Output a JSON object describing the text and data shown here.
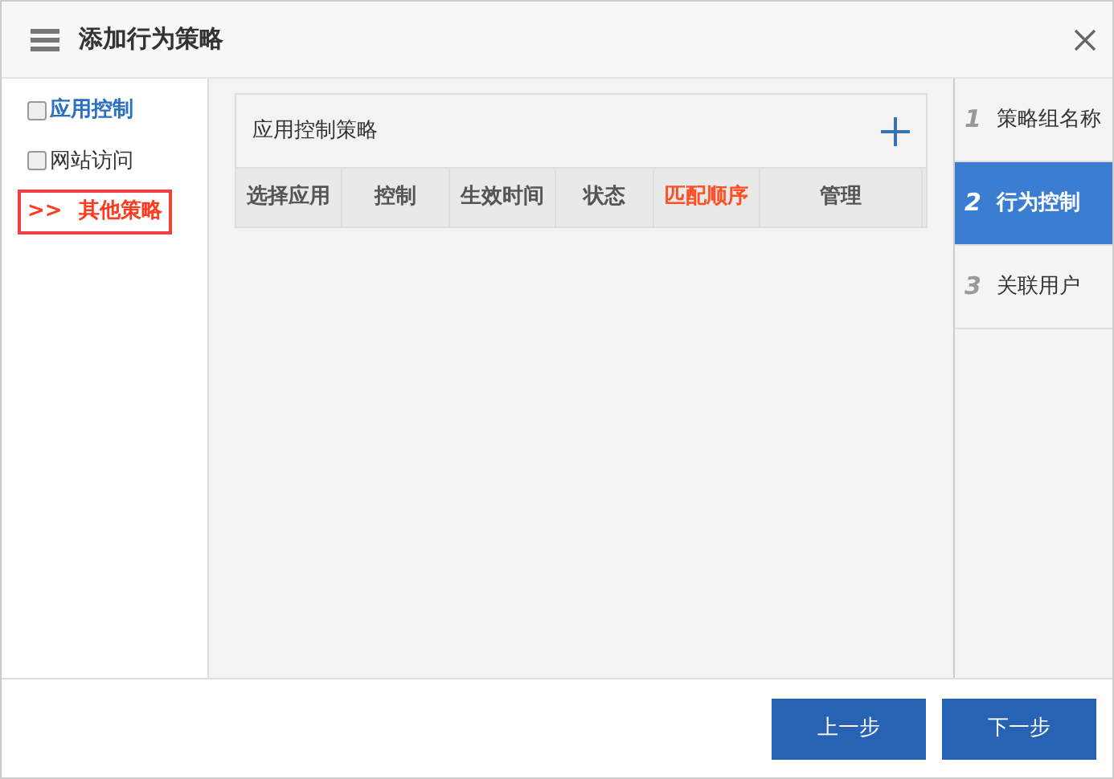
{
  "window": {
    "title": "添加行为策略"
  },
  "left_nav": [
    {
      "kind": "checkbox",
      "label": "应用控制",
      "checked": false,
      "highlighted": true,
      "selected": false
    },
    {
      "kind": "checkbox",
      "label": "网站访问",
      "checked": false,
      "highlighted": false,
      "selected": false
    },
    {
      "kind": "current",
      "marker": ">>",
      "label": "其他策略",
      "selected": true
    }
  ],
  "panel": {
    "title": "应用控制策略",
    "columns": [
      {
        "label": "选择应用",
        "highlighted": false
      },
      {
        "label": "控制",
        "highlighted": false
      },
      {
        "label": "生效时间",
        "highlighted": false
      },
      {
        "label": "状态",
        "highlighted": false
      },
      {
        "label": "匹配顺序",
        "highlighted": true
      },
      {
        "label": "管理",
        "highlighted": false
      }
    ]
  },
  "steps": [
    {
      "number": "1",
      "label": "策略组名称",
      "selected": false
    },
    {
      "number": "2",
      "label": "行为控制",
      "selected": true
    },
    {
      "number": "3",
      "label": "关联用户",
      "selected": false
    }
  ],
  "buttons": [
    {
      "label": "上一步"
    },
    {
      "label": "下一步"
    }
  ]
}
